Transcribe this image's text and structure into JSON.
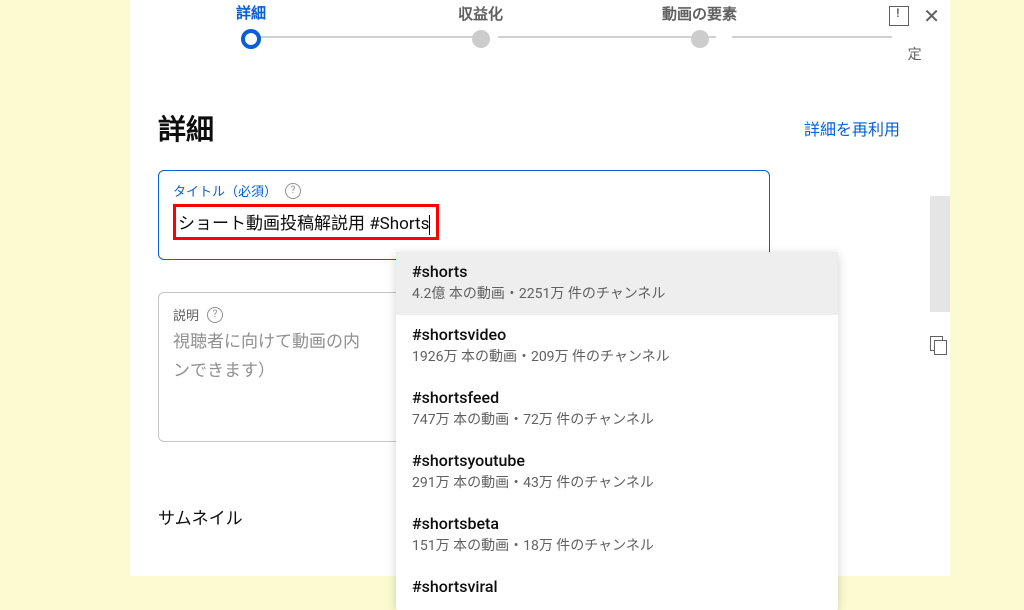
{
  "stepper": {
    "steps": [
      {
        "label": "詳細",
        "active": true
      },
      {
        "label": "収益化",
        "active": false
      },
      {
        "label": "動画の要素",
        "active": false
      }
    ]
  },
  "header": {
    "title": "詳細",
    "reuse_link": "詳細を再利用"
  },
  "title_field": {
    "label": "タイトル（必須）",
    "value": "ショート動画投稿解説用 #Shorts"
  },
  "description_field": {
    "label": "説明",
    "placeholder": "視聴者に向けて動画の内容を紹介しましょう（@ でチャンネルをメンションできます）",
    "placeholder_visible": "視聴者に向けて動画の内\nンできます）"
  },
  "autocomplete": {
    "items": [
      {
        "tag": "#shorts",
        "stats": "4.2億 本の動画・2251万 件のチャンネル",
        "hover": true
      },
      {
        "tag": "#shortsvideo",
        "stats": "1926万 本の動画・209万 件のチャンネル",
        "hover": false
      },
      {
        "tag": "#shortsfeed",
        "stats": "747万 本の動画・72万 件のチャンネル",
        "hover": false
      },
      {
        "tag": "#shortsyoutube",
        "stats": "291万 本の動画・43万 件のチャンネル",
        "hover": false
      },
      {
        "tag": "#shortsbeta",
        "stats": "151万 本の動画・18万 件のチャンネル",
        "hover": false
      },
      {
        "tag": "#shortsviral",
        "stats": "",
        "hover": false
      }
    ]
  },
  "thumbnail_heading": "サムネイル",
  "sidebar": {
    "text": "定"
  }
}
